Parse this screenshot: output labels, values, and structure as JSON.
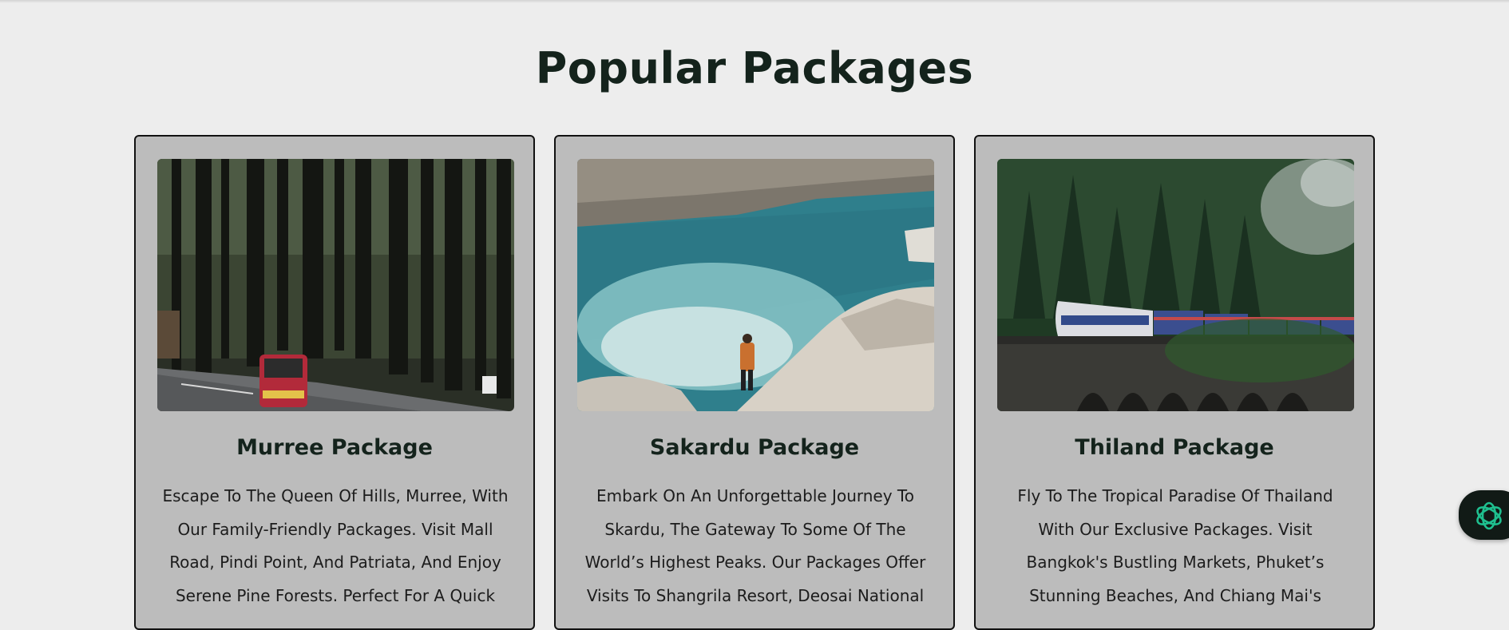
{
  "section": {
    "title": "Popular Packages"
  },
  "packages": [
    {
      "title": "Murree Package",
      "description": "Escape To The Queen Of Hills, Murree, With Our Family-Friendly Packages. Visit Mall Road, Pindi Point, And Patriata, And Enjoy Serene Pine Forests. Perfect For A Quick"
    },
    {
      "title": "Sakardu Package",
      "description": "Embark On An Unforgettable Journey To Skardu, The Gateway To Some Of The World’s Highest Peaks. Our Packages Offer Visits To Shangrila Resort, Deosai National"
    },
    {
      "title": "Thiland Package",
      "description": "Fly To The Tropical Paradise Of Thailand With Our Exclusive Packages. Visit Bangkok's Bustling Markets, Phuket’s Stunning Beaches, And Chiang Mai's"
    }
  ],
  "colors": {
    "background": "#ededed",
    "card": "#bcbcbc",
    "heading": "#14231c",
    "widget": "#111a16",
    "widget_icon": "#1fbf8f"
  },
  "icons": {
    "chat_widget": "chatbot-icon"
  }
}
